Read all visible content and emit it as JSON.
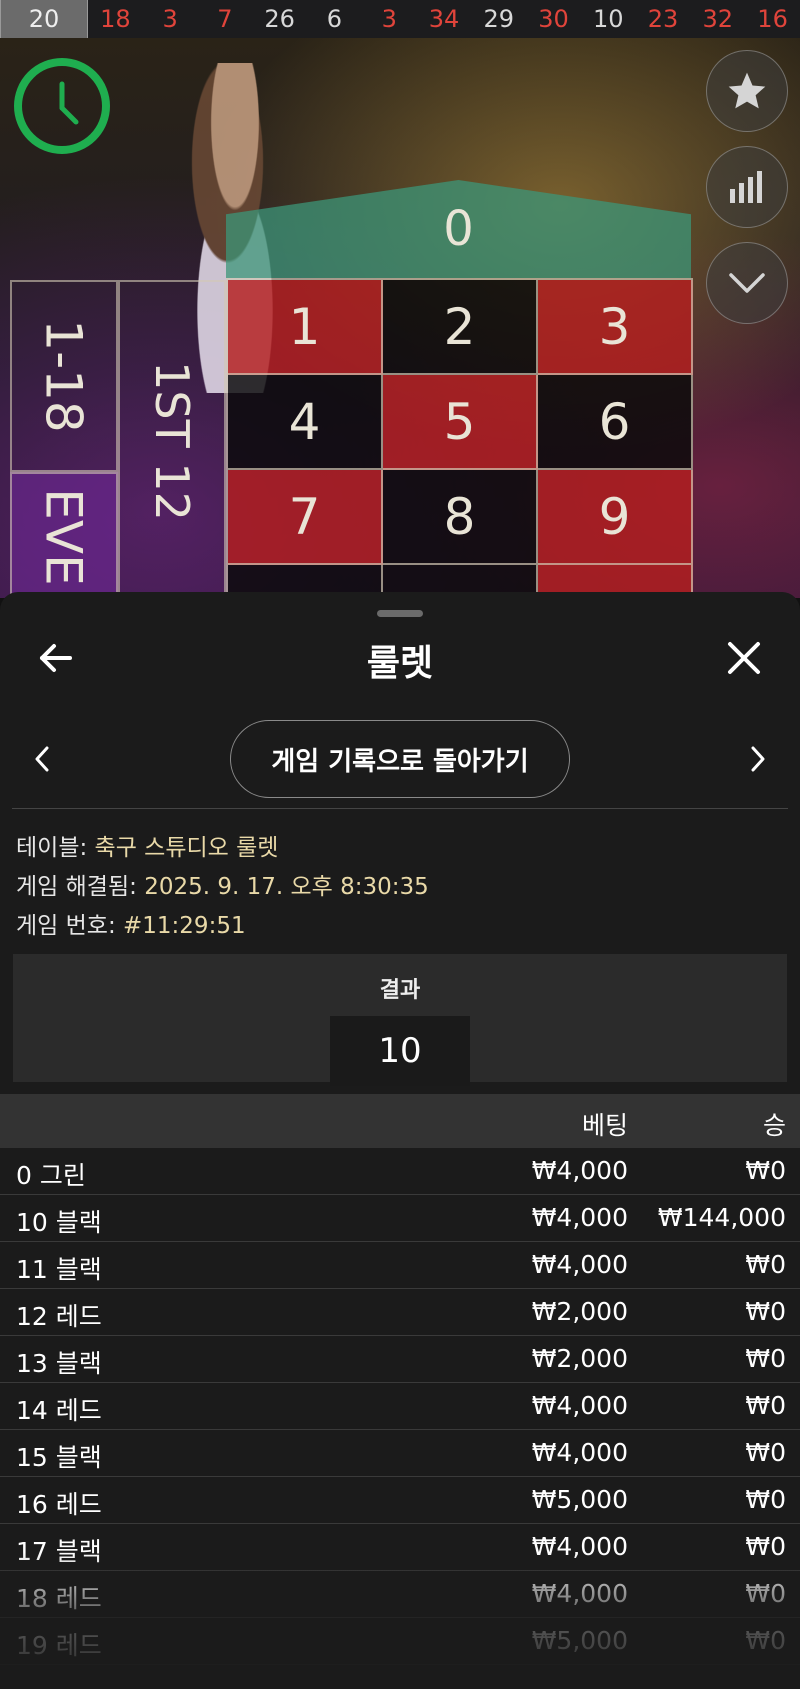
{
  "history": {
    "numbers": [
      {
        "n": "20",
        "color": "black"
      },
      {
        "n": "18",
        "color": "red"
      },
      {
        "n": "3",
        "color": "red"
      },
      {
        "n": "7",
        "color": "red"
      },
      {
        "n": "26",
        "color": "black"
      },
      {
        "n": "6",
        "color": "black"
      },
      {
        "n": "3",
        "color": "red"
      },
      {
        "n": "34",
        "color": "red"
      },
      {
        "n": "29",
        "color": "black"
      },
      {
        "n": "30",
        "color": "red"
      },
      {
        "n": "10",
        "color": "black"
      },
      {
        "n": "23",
        "color": "red"
      },
      {
        "n": "32",
        "color": "red"
      },
      {
        "n": "16",
        "color": "red"
      }
    ]
  },
  "table": {
    "zero": "0",
    "cells": [
      {
        "n": "1",
        "c": "r"
      },
      {
        "n": "2",
        "c": "b"
      },
      {
        "n": "3",
        "c": "r"
      },
      {
        "n": "4",
        "c": "b"
      },
      {
        "n": "5",
        "c": "r"
      },
      {
        "n": "6",
        "c": "b"
      },
      {
        "n": "7",
        "c": "r"
      },
      {
        "n": "8",
        "c": "b"
      },
      {
        "n": "9",
        "c": "r"
      },
      {
        "n": "",
        "c": "b"
      },
      {
        "n": "",
        "c": "b"
      },
      {
        "n": "",
        "c": "r"
      }
    ],
    "low_label": "1-18",
    "even_label": "EVE",
    "dozen_label": "1ST 12"
  },
  "side_buttons": [
    "star-icon",
    "stats-icon",
    "chevron-down-icon"
  ],
  "sheet": {
    "title": "룰렛",
    "back_button": "게임 기록으로 돌아가기",
    "info": {
      "table_label": "테이블:",
      "table_value": "축구 스튜디오 룰렛",
      "resolved_label": "게임 해결됨:",
      "resolved_value": "2025. 9. 17. 오후 8:30:35",
      "game_no_label": "게임 번호:",
      "game_no_value": "#11:29:51"
    },
    "result_label": "결과",
    "result_value": "10",
    "columns": {
      "bet": "베팅",
      "win": "승"
    },
    "rows": [
      {
        "name": "0 그린",
        "bet": "₩4,000",
        "win": "₩0"
      },
      {
        "name": "10 블랙",
        "bet": "₩4,000",
        "win": "₩144,000"
      },
      {
        "name": "11 블랙",
        "bet": "₩4,000",
        "win": "₩0"
      },
      {
        "name": "12 레드",
        "bet": "₩2,000",
        "win": "₩0"
      },
      {
        "name": "13 블랙",
        "bet": "₩2,000",
        "win": "₩0"
      },
      {
        "name": "14 레드",
        "bet": "₩4,000",
        "win": "₩0"
      },
      {
        "name": "15 블랙",
        "bet": "₩4,000",
        "win": "₩0"
      },
      {
        "name": "16 레드",
        "bet": "₩5,000",
        "win": "₩0"
      },
      {
        "name": "17 블랙",
        "bet": "₩4,000",
        "win": "₩0"
      },
      {
        "name": "18 레드",
        "bet": "₩4,000",
        "win": "₩0"
      },
      {
        "name": "19 레드",
        "bet": "₩5,000",
        "win": "₩0"
      }
    ]
  },
  "colors": {
    "red": "#e0443b",
    "green": "#1fae4f",
    "accent": "#e9d9a8"
  }
}
